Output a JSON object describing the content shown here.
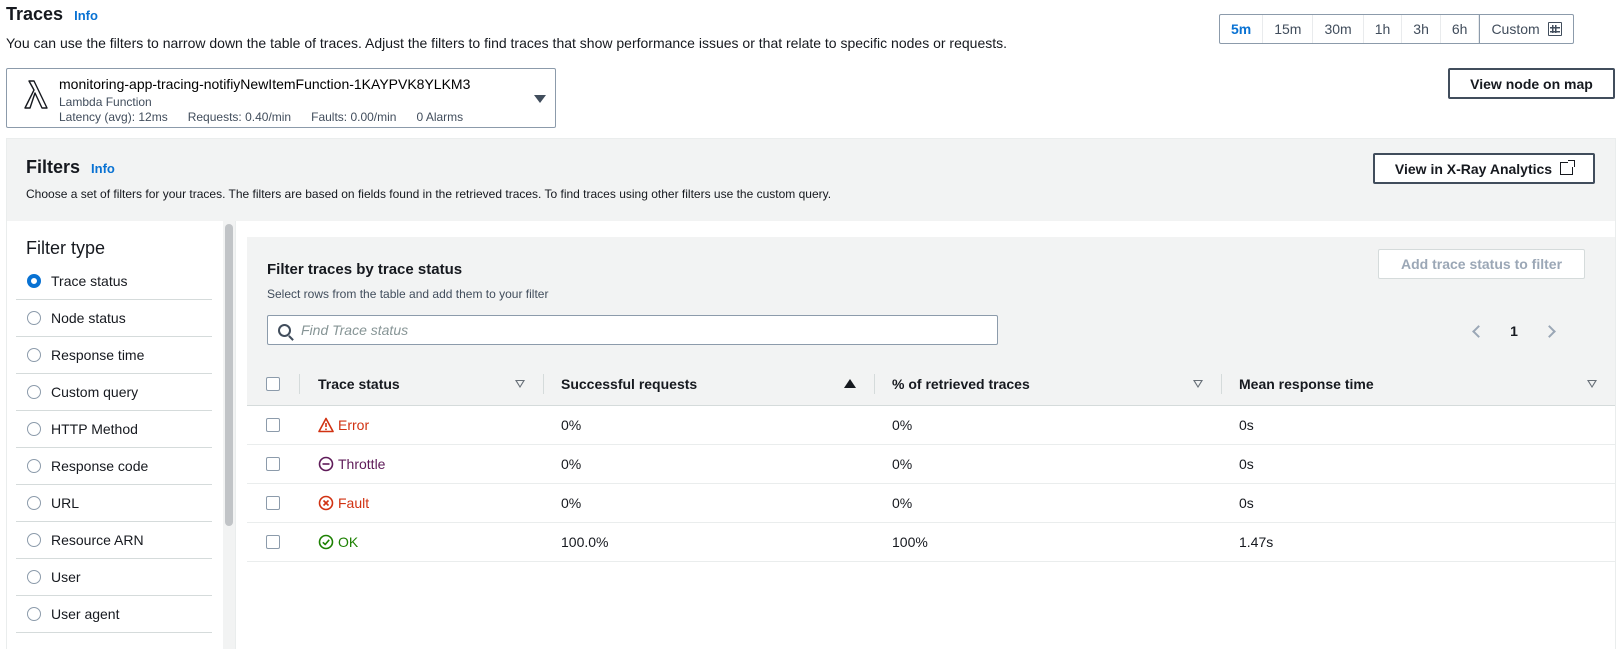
{
  "header": {
    "title": "Traces",
    "info": "Info",
    "description": "You can use the filters to narrow down the table of traces. Adjust the filters to find traces that show performance issues or that relate to specific nodes or requests."
  },
  "time_range": {
    "options": [
      "5m",
      "15m",
      "30m",
      "1h",
      "3h",
      "6h"
    ],
    "selected": "5m",
    "custom_label": "Custom"
  },
  "node": {
    "name": "monitoring-app-tracing-notifiyNewItemFunction-1KAYPVK8YLKM3",
    "type": "Lambda Function",
    "latency": "Latency (avg): 12ms",
    "requests": "Requests: 0.40/min",
    "faults": "Faults: 0.00/min",
    "alarms": "0 Alarms"
  },
  "view_node_button": "View node on map",
  "filters": {
    "title": "Filters",
    "info": "Info",
    "description": "Choose a set of filters for your traces. The filters are based on fields found in the retrieved traces. To find traces using other filters use the custom query.",
    "xray_button": "View in X-Ray Analytics",
    "filter_type_title": "Filter type",
    "filter_types": [
      "Trace status",
      "Node status",
      "Response time",
      "Custom query",
      "HTTP Method",
      "Response code",
      "URL",
      "Resource ARN",
      "User",
      "User agent"
    ],
    "selected_filter_type": "Trace status"
  },
  "status_card": {
    "title": "Filter traces by trace status",
    "description": "Select rows from the table and add them to your filter",
    "add_button": "Add trace status to filter",
    "search_placeholder": "Find Trace status",
    "page": "1",
    "columns": [
      "Trace status",
      "Successful requests",
      "% of retrieved traces",
      "Mean response time"
    ],
    "rows": [
      {
        "status": "Error",
        "icon": "warning-icon",
        "successful": "0%",
        "pct": "0%",
        "mean": "0s"
      },
      {
        "status": "Throttle",
        "icon": "throttle-icon",
        "successful": "0%",
        "pct": "0%",
        "mean": "0s"
      },
      {
        "status": "Fault",
        "icon": "fault-icon",
        "successful": "0%",
        "pct": "0%",
        "mean": "0s"
      },
      {
        "status": "OK",
        "icon": "ok-icon",
        "successful": "100.0%",
        "pct": "100%",
        "mean": "1.47s"
      }
    ]
  },
  "colors": {
    "accent": "#0972d3",
    "error": "#d13212",
    "throttle": "#5f1b59",
    "ok": "#1d8102"
  }
}
